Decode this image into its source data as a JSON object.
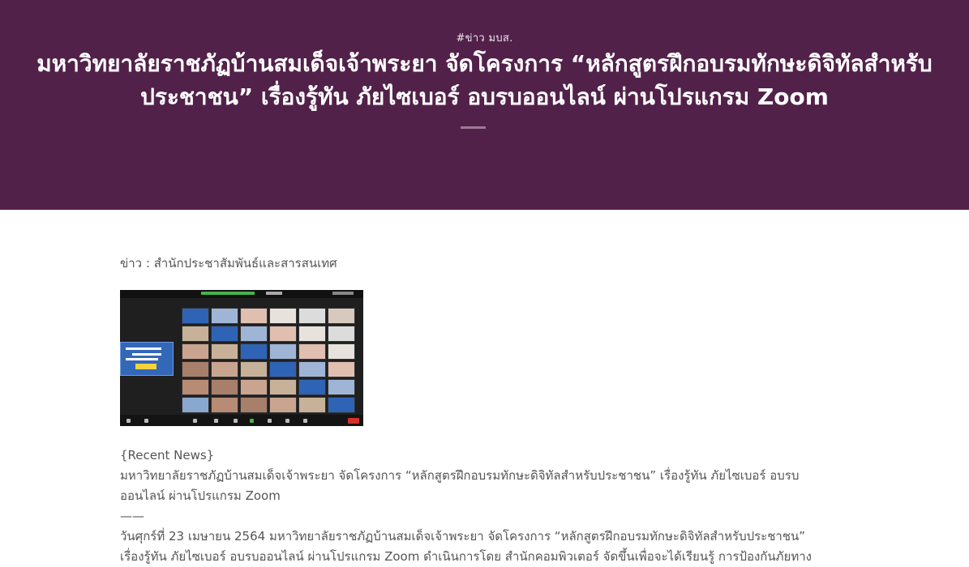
{
  "hero": {
    "tag": "#ข่าว มบส.",
    "title": "มหาวิทยาลัยราชภัฏบ้านสมเด็จเจ้าพระยา จัดโครงการ “หลักสูตรฝึกอบรมทักษะดิจิทัลสำหรับประชาชน” เรื่องรู้ทัน ภัยไซเบอร์ อบรบออนไลน์ ผ่านโปรแกรม Zoom"
  },
  "content": {
    "source": "ข่าว : สำนักประชาสัมพันธ์และสารสนเทศ",
    "recent_news_label": "{Recent News}",
    "headline": "มหาวิทยาลัยราชภัฏบ้านสมเด็จเจ้าพระยา จัดโครงการ “หลักสูตรฝึกอบรมทักษะดิจิทัลสำหรับประชาชน” เรื่องรู้ทัน ภัยไซเบอร์ อบรบออนไลน์ ผ่านโปรแกรม Zoom",
    "separator": "——",
    "body": "วันศุกร์ที่ 23 เมษายน 2564 มหาวิทยาลัยราชภัฏบ้านสมเด็จเจ้าพระยา จัดโครงการ “หลักสูตรฝึกอบรมทักษะดิจิทัลสำหรับประชาชน” เรื่องรู้ทัน ภัยไซเบอร์ อบรบออนไลน์ ผ่านโปรแกรม Zoom ดำเนินการโดย สำนักคอมพิวเตอร์ จัดขึ้นเพื่อจะได้เรียนรู้ การป้องกันภัยทาง"
  },
  "colors": {
    "hero_bg": "#52214a",
    "body_text": "#555555"
  }
}
